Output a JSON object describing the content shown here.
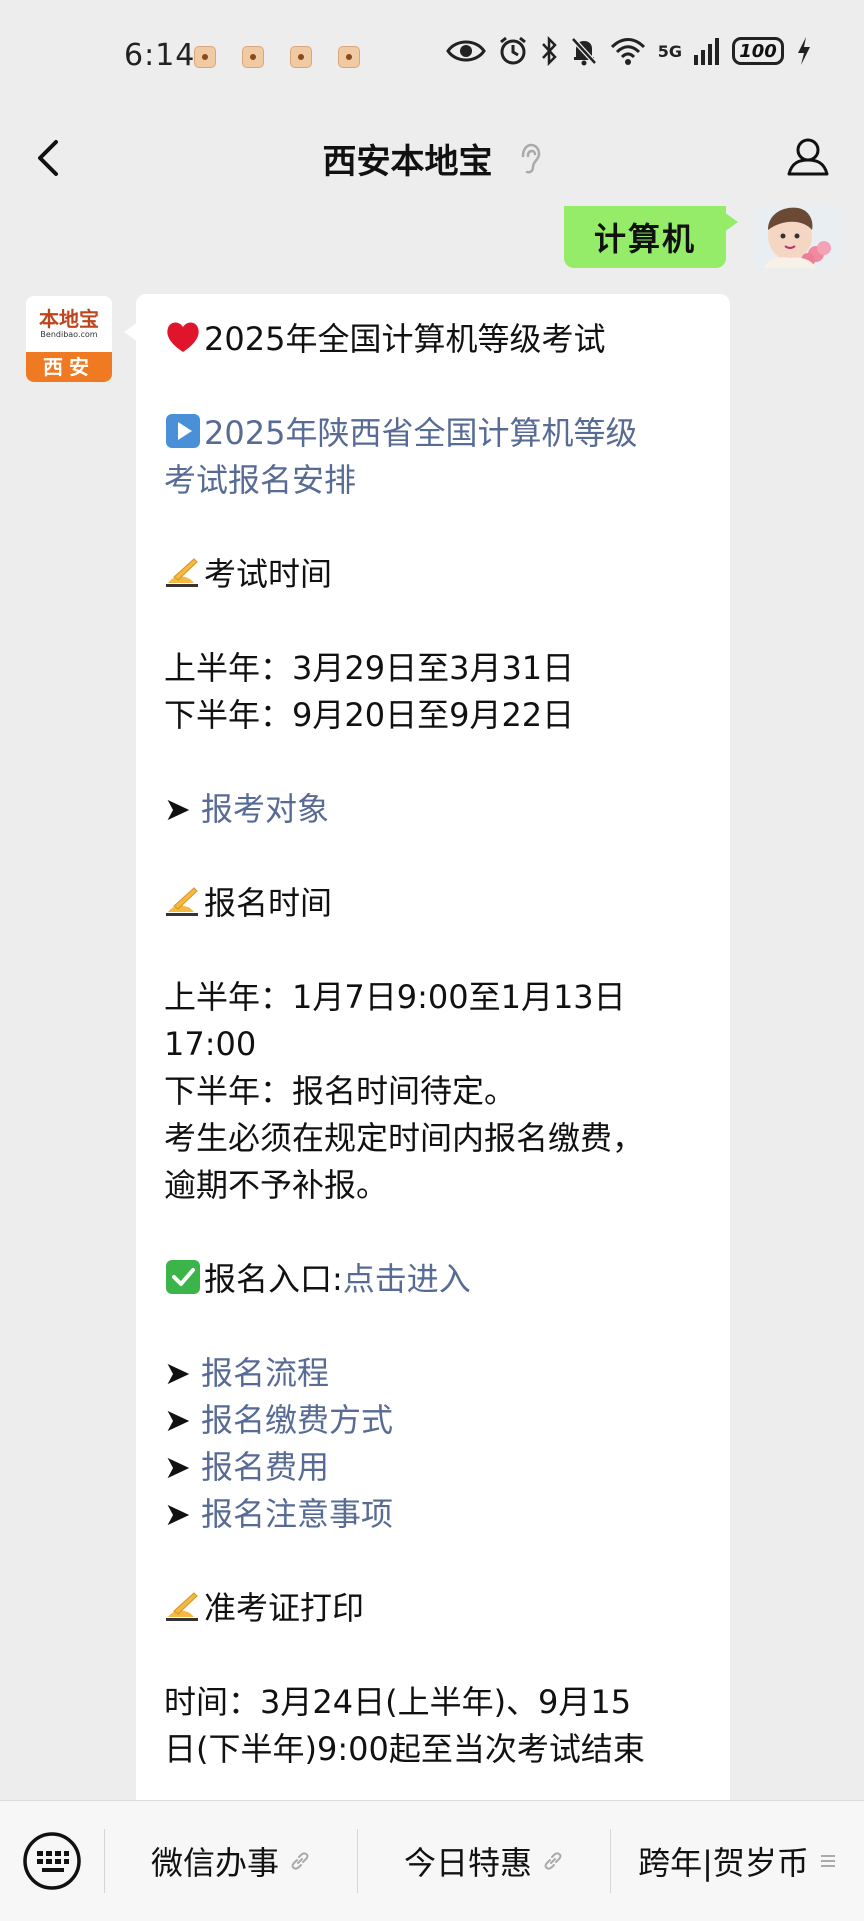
{
  "status_bar": {
    "time": "6:14",
    "network": "5G",
    "battery": "100"
  },
  "nav": {
    "title": "西安本地宝"
  },
  "sent_message": {
    "text": "计算机"
  },
  "bot_avatar": {
    "logo_text": "本地宝",
    "logo_domain": "Bendibao.com",
    "city": "西安"
  },
  "message": {
    "title": "2025年全国计算机等级考试",
    "link_line1": "2025年陕西省全国计算机等级",
    "link_line2": "考试报名安排",
    "exam_time_heading": "考试时间",
    "exam_time_first": "上半年：3月29日至3月31日",
    "exam_time_second": "下半年：9月20日至9月22日",
    "arrow": "➤",
    "applicants_link": "报考对象",
    "reg_time_heading": "报名时间",
    "reg_first_a": "上半年：1月7日9:00至1月13日",
    "reg_first_b": "17:00",
    "reg_second": "下半年：报名时间待定。",
    "reg_note_a": "考生必须在规定时间内报名缴费，",
    "reg_note_b": "逾期不予补报。",
    "entry_label": "报名入口:",
    "entry_link": "点击进入",
    "process_link": "报名流程",
    "payment_link": "报名缴费方式",
    "fee_link": "报名费用",
    "notes_link": "报名注意事项",
    "admission_heading": "准考证打印",
    "admission_a": "时间：3月24日(上半年)、9月15",
    "admission_b": "日(下半年)9:00起至当次考试结束"
  },
  "bottom_menu": {
    "item1": "微信办事",
    "item2": "今日特惠",
    "item3": "跨年|贺岁币"
  },
  "colors": {
    "background": "#ededed",
    "sent_bubble": "#95ec69",
    "link": "#576b95",
    "avatar_orange": "#f07a22"
  },
  "icons": [
    "back-arrow-icon",
    "ear-icon",
    "profile-icon",
    "heart-icon",
    "play-icon",
    "writing-hand-icon",
    "check-icon",
    "keyboard-icon",
    "link-icon",
    "menu-lines-icon"
  ]
}
